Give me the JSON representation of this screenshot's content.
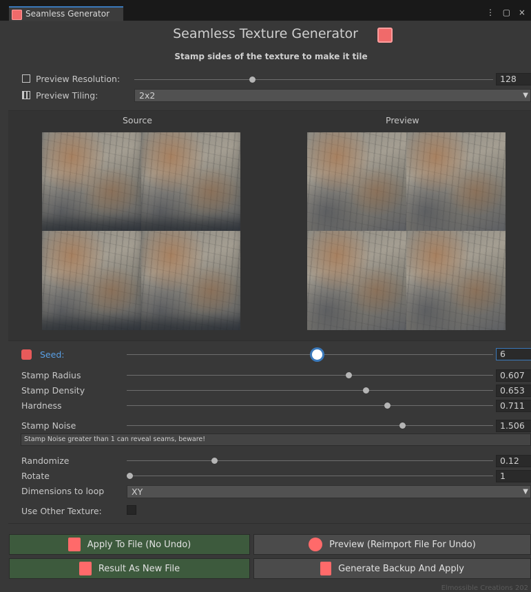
{
  "tab": {
    "label": "Seamless Generator",
    "controls": "⋮ ▢ ×"
  },
  "header": {
    "title": "Seamless Texture Generator",
    "subtitle": "Stamp sides of the texture to make it tile"
  },
  "preview_resolution": {
    "label": "Preview Resolution:",
    "value": "128",
    "level": 0.33
  },
  "preview_tiling": {
    "label": "Preview Tiling:",
    "value": "2x2"
  },
  "panels": {
    "source_label": "Source",
    "preview_label": "Preview"
  },
  "seed": {
    "label": "Seed:",
    "value": "6",
    "level": 0.52
  },
  "params": [
    {
      "label": "Stamp Radius",
      "value": "0.607",
      "level": 0.607
    },
    {
      "label": "Stamp Density",
      "value": "0.653",
      "level": 0.653
    },
    {
      "label": "Hardness",
      "value": "0.711",
      "level": 0.711
    },
    {
      "label": "Stamp Noise",
      "value": "1.506",
      "level": 0.753
    }
  ],
  "warning": "Stamp Noise greater than 1 can reveal seams, beware!",
  "randomize": {
    "label": "Randomize",
    "value": "0.12",
    "level": 0.24
  },
  "rotate": {
    "label": "Rotate",
    "value": "1",
    "level": 0.0
  },
  "dimensions": {
    "label": "Dimensions to loop",
    "value": "XY"
  },
  "use_other_texture": {
    "label": "Use Other Texture:",
    "checked": false
  },
  "buttons": {
    "apply_to_file": "Apply To File (No Undo)",
    "preview_reimport": "Preview (Reimport File For Undo)",
    "result_new_file": "Result As New File",
    "generate_backup": "Generate Backup And Apply"
  },
  "footer": "Elmossible Creations 202",
  "colors": {
    "accent_blue": "#3a79bb",
    "icon_red": "#f06a6a",
    "button_green": "#3d5a3d",
    "button_gray": "#4b4b4b"
  }
}
